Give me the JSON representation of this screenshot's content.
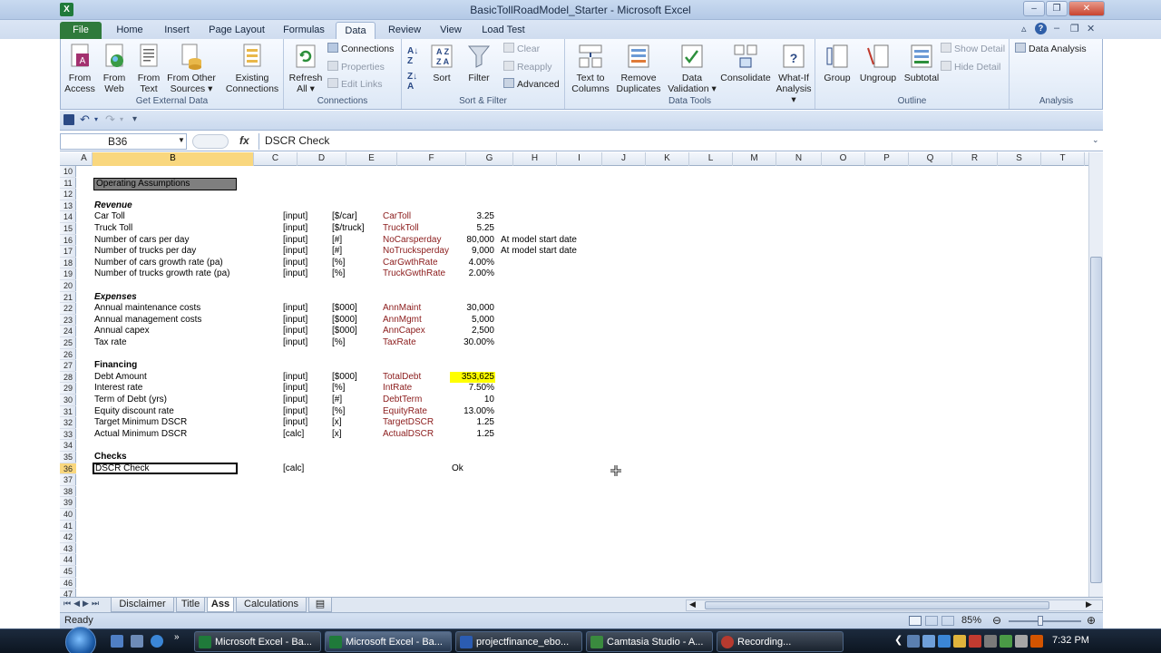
{
  "window": {
    "title": "BasicTollRoadModel_Starter - Microsoft Excel",
    "app_letter": "X"
  },
  "tabs": {
    "file": "File",
    "items": [
      "Home",
      "Insert",
      "Page Layout",
      "Formulas",
      "Data",
      "Review",
      "View",
      "Load Test"
    ],
    "active": "Data"
  },
  "ribbon": {
    "get_external_data": {
      "label": "Get External Data",
      "buttons": [
        {
          "l1": "From",
          "l2": "Access"
        },
        {
          "l1": "From",
          "l2": "Web"
        },
        {
          "l1": "From",
          "l2": "Text"
        },
        {
          "l1": "From Other",
          "l2": "Sources ▾"
        },
        {
          "l1": "Existing",
          "l2": "Connections"
        }
      ]
    },
    "connections": {
      "label": "Connections",
      "refresh_l1": "Refresh",
      "refresh_l2": "All ▾",
      "connections": "Connections",
      "properties": "Properties",
      "edit_links": "Edit Links"
    },
    "sort_filter": {
      "label": "Sort & Filter",
      "sort": "Sort",
      "filter": "Filter",
      "clear": "Clear",
      "reapply": "Reapply",
      "advanced": "Advanced"
    },
    "data_tools": {
      "label": "Data Tools",
      "text_to_columns_l1": "Text to",
      "text_to_columns_l2": "Columns",
      "remove_dup_l1": "Remove",
      "remove_dup_l2": "Duplicates",
      "data_val_l1": "Data",
      "data_val_l2": "Validation ▾",
      "consolidate": "Consolidate",
      "whatif_l1": "What-If",
      "whatif_l2": "Analysis ▾"
    },
    "outline": {
      "label": "Outline",
      "group": "Group",
      "ungroup": "Ungroup",
      "subtotal": "Subtotal",
      "show_detail": "Show Detail",
      "hide_detail": "Hide Detail"
    },
    "analysis": {
      "label": "Analysis",
      "data_analysis": "Data Analysis"
    }
  },
  "formula_bar": {
    "name_box": "B36",
    "fx": "fx",
    "content": "DSCR Check"
  },
  "columns": [
    "A",
    "B",
    "C",
    "D",
    "E",
    "F",
    "G",
    "H",
    "I",
    "J",
    "K",
    "L",
    "M",
    "N",
    "O",
    "P",
    "Q",
    "R",
    "S",
    "T"
  ],
  "selected_column": "B",
  "rows": [
    "10",
    "11",
    "12",
    "13",
    "14",
    "15",
    "16",
    "17",
    "18",
    "19",
    "20",
    "21",
    "22",
    "23",
    "24",
    "25",
    "26",
    "27",
    "28",
    "29",
    "30",
    "31",
    "32",
    "33",
    "34",
    "35",
    "36",
    "37",
    "38",
    "39",
    "40",
    "41",
    "42",
    "43",
    "44",
    "45",
    "46",
    "47"
  ],
  "selected_row": "36",
  "sheet": {
    "operating_assumptions": "Operating Assumptions",
    "revenue": "Revenue",
    "expenses": "Expenses",
    "financing": "Financing",
    "checks": "Checks",
    "lines": [
      {
        "row": "14",
        "label": "Car Toll",
        "type": "[input]",
        "unit": "[$/car]",
        "name": "CarToll",
        "value": "3.25"
      },
      {
        "row": "15",
        "label": "Truck Toll",
        "type": "[input]",
        "unit": "[$/truck]",
        "name": "TruckToll",
        "value": "5.25"
      },
      {
        "row": "16",
        "label": "Number of cars per day",
        "type": "[input]",
        "unit": "[#]",
        "name": "NoCarsperday",
        "value": "80,000",
        "note": "At model start date"
      },
      {
        "row": "17",
        "label": "Number of trucks per day",
        "type": "[input]",
        "unit": "[#]",
        "name": "NoTrucksperday",
        "value": "9,000",
        "note": "At model start date"
      },
      {
        "row": "18",
        "label": "Number of cars growth rate (pa)",
        "type": "[input]",
        "unit": "[%]",
        "name": "CarGwthRate",
        "value": "4.00%"
      },
      {
        "row": "19",
        "label": "Number of trucks growth rate (pa)",
        "type": "[input]",
        "unit": "[%]",
        "name": "TruckGwthRate",
        "value": "2.00%"
      },
      {
        "row": "22",
        "label": "Annual maintenance costs",
        "type": "[input]",
        "unit": "[$000]",
        "name": "AnnMaint",
        "value": "30,000"
      },
      {
        "row": "23",
        "label": "Annual management costs",
        "type": "[input]",
        "unit": "[$000]",
        "name": "AnnMgmt",
        "value": "5,000"
      },
      {
        "row": "24",
        "label": "Annual capex",
        "type": "[input]",
        "unit": "[$000]",
        "name": "AnnCapex",
        "value": "2,500"
      },
      {
        "row": "25",
        "label": "Tax rate",
        "type": "[input]",
        "unit": "[%]",
        "name": "TaxRate",
        "value": "30.00%"
      },
      {
        "row": "28",
        "label": "Debt Amount",
        "type": "[input]",
        "unit": "[$000]",
        "name": "TotalDebt",
        "value": "353,625",
        "highlight": "#ffff00"
      },
      {
        "row": "29",
        "label": "Interest rate",
        "type": "[input]",
        "unit": "[%]",
        "name": "IntRate",
        "value": "7.50%"
      },
      {
        "row": "30",
        "label": "Term of Debt (yrs)",
        "type": "[input]",
        "unit": "[#]",
        "name": "DebtTerm",
        "value": "10"
      },
      {
        "row": "31",
        "label": "Equity discount rate",
        "type": "[input]",
        "unit": "[%]",
        "name": "EquityRate",
        "value": "13.00%"
      },
      {
        "row": "32",
        "label": "Target Minimum DSCR",
        "type": "[input]",
        "unit": "[x]",
        "name": "TargetDSCR",
        "value": "1.25"
      },
      {
        "row": "33",
        "label": "Actual Minimum DSCR",
        "type": "[calc]",
        "unit": "[x]",
        "name": "ActualDSCR",
        "value": "1.25"
      }
    ],
    "check": {
      "label": "DSCR Check",
      "type": "[calc]",
      "value": "Ok"
    }
  },
  "sheet_tabs": [
    "Disclaimer",
    "Title",
    "Ass",
    "Calculations"
  ],
  "active_sheet_tab": "Ass",
  "status": {
    "ready": "Ready",
    "zoom": "85%"
  },
  "taskbar": {
    "items": [
      "Microsoft Excel - Ba...",
      "Microsoft Excel - Ba...",
      "projectfinance_ebo...",
      "Camtasia Studio - A...",
      "Recording..."
    ],
    "clock": "7:32 PM"
  },
  "colors": {
    "file_tab": "#2f7a3b",
    "name_text": "#8b1b1b",
    "highlight": "#ffff00",
    "selected_header": "#f9d77e"
  }
}
